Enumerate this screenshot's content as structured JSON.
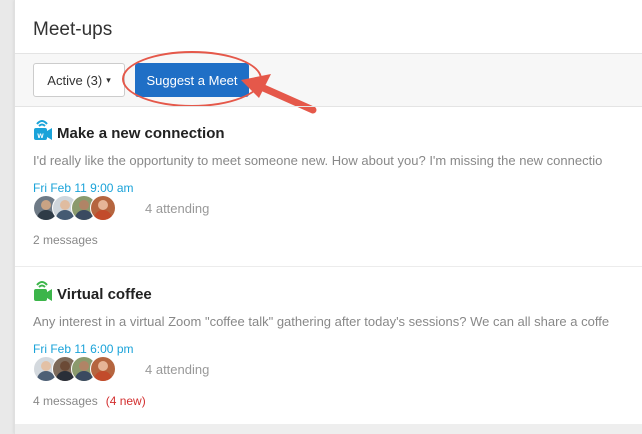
{
  "header": {
    "title": "Meet-ups"
  },
  "toolbar": {
    "filter_label": "Active (3)",
    "filter_caret": "▾",
    "suggest_label": "Suggest a Meet"
  },
  "colors": {
    "accent": "#1f6fc6",
    "highlight": "#e5584a",
    "date": "#1aa3d9",
    "new": "#d32f2f",
    "camera_blue": "#1aa3d9",
    "camera_green": "#3cb54a"
  },
  "meetups": [
    {
      "icon": "blue-video-camera-icon",
      "title": "Make a new connection",
      "description": "I'd really like the opportunity to meet someone new. How about you? I'm missing the new connectio",
      "date": "Fri Feb 11 9:00 am",
      "attending": "4 attending",
      "messages": "2 messages",
      "new": ""
    },
    {
      "icon": "green-video-camera-icon",
      "title": "Virtual coffee",
      "description": "Any interest in a virtual Zoom \"coffee talk\" gathering after today's sessions? We can all share a coffe",
      "date": "Fri Feb 11 6:00 pm",
      "attending": "4 attending",
      "messages": "4 messages",
      "new": "(4 new)"
    }
  ]
}
